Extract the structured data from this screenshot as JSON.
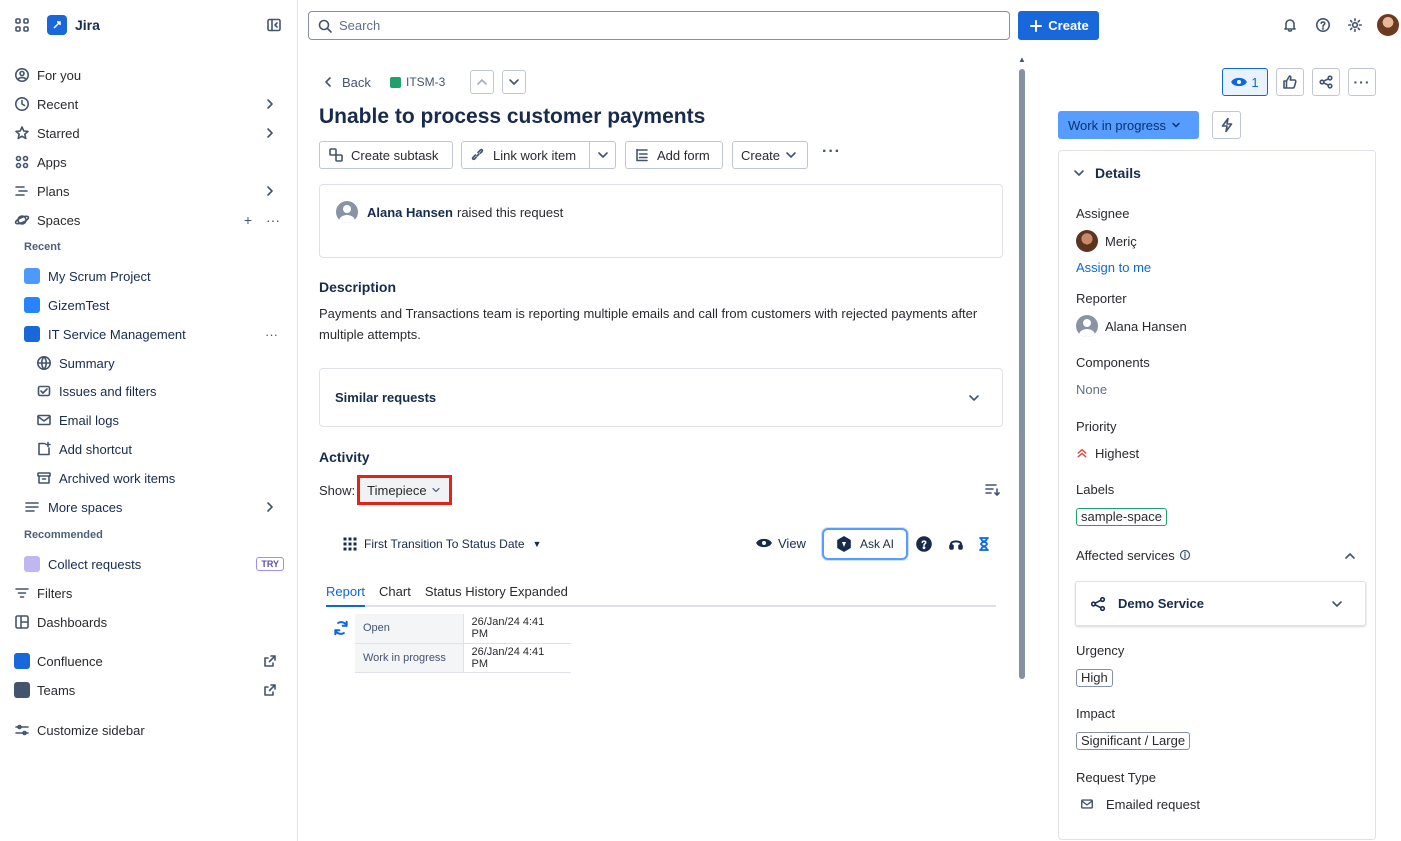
{
  "app": {
    "name": "Jira"
  },
  "sidebar": {
    "nav_top": [
      {
        "label": "For you",
        "icon": "user-circle-icon"
      },
      {
        "label": "Recent",
        "icon": "clock-icon"
      },
      {
        "label": "Starred",
        "icon": "star-icon"
      },
      {
        "label": "Apps",
        "icon": "apps-icon"
      },
      {
        "label": "Plans",
        "icon": "plans-icon"
      },
      {
        "label": "Spaces",
        "icon": "spaces-icon"
      }
    ],
    "recent_label": "Recent",
    "projects": [
      {
        "label": "My Scrum Project"
      },
      {
        "label": "GizemTest"
      },
      {
        "label": "IT Service Management"
      }
    ],
    "sub_items": [
      {
        "label": "Summary",
        "icon": "globe-icon"
      },
      {
        "label": "Issues and filters",
        "icon": "issues-icon"
      },
      {
        "label": "Email logs",
        "icon": "mail-icon"
      },
      {
        "label": "Add shortcut",
        "icon": "add-shortcut-icon"
      },
      {
        "label": "Archived work items",
        "icon": "archive-icon"
      }
    ],
    "more_spaces": "More spaces",
    "recommended_label": "Recommended",
    "collect_requests": "Collect requests",
    "try_badge": "TRY",
    "filters": "Filters",
    "dashboards": "Dashboards",
    "confluence": "Confluence",
    "teams": "Teams",
    "customize": "Customize sidebar"
  },
  "topbar": {
    "search_placeholder": "Search",
    "create_label": "Create"
  },
  "issue": {
    "back_label": "Back",
    "key": "ITSM-3",
    "title": "Unable to process customer payments",
    "toolbar": {
      "create_subtask": "Create subtask",
      "link_work_item": "Link work item",
      "add_form": "Add form",
      "create": "Create"
    },
    "requester_name": "Alana Hansen",
    "requester_suffix": "raised this request",
    "description_heading": "Description",
    "description_text": "Payments and Transactions team is reporting multiple emails and call from customers with rejected payments after multiple attempts.",
    "similar_requests": "Similar requests",
    "activity_heading": "Activity",
    "show_label": "Show:",
    "show_selected": "Timepiece"
  },
  "timepiece": {
    "report_type": "First Transition To Status Date",
    "view_label": "View",
    "ask_ai_label": "Ask AI",
    "tabs": [
      "Report",
      "Chart",
      "Status History Expanded"
    ],
    "rows": [
      {
        "status": "Open",
        "date": "26/Jan/24 4:41 PM"
      },
      {
        "status": "Work in progress",
        "date": "26/Jan/24 4:41 PM"
      }
    ]
  },
  "right_panel": {
    "watch_count": "1",
    "status": "Work in progress",
    "details_heading": "Details",
    "assignee_label": "Assignee",
    "assignee_name": "Meriç",
    "assign_to_me": "Assign to me",
    "reporter_label": "Reporter",
    "reporter_name": "Alana Hansen",
    "components_label": "Components",
    "components_value": "None",
    "priority_label": "Priority",
    "priority_value": "Highest",
    "labels_label": "Labels",
    "labels_value": "sample-space",
    "affected_label": "Affected services",
    "affected_service": "Demo Service",
    "urgency_label": "Urgency",
    "urgency_value": "High",
    "impact_label": "Impact",
    "impact_value": "Significant / Large",
    "request_type_label": "Request Type",
    "request_type_value": "Emailed request"
  },
  "colors": {
    "brand": "#1868db",
    "highlight_border": "#e2231a",
    "status_bg": "#579dff",
    "priority": "#e2483d"
  }
}
